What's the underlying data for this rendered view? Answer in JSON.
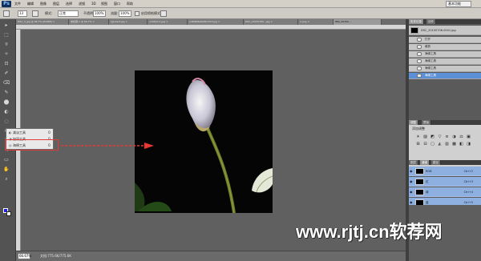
{
  "app": {
    "logo": "Ps",
    "workspace": "基本功能"
  },
  "menu_items": [
    "文件",
    "编辑",
    "图像",
    "图层",
    "选择",
    "滤镜",
    "3D",
    "视图",
    "窗口",
    "帮助"
  ],
  "options": {
    "brush_size": "13",
    "mode_label": "模式:",
    "mode_value": "正常",
    "opacity_label": "不透明度:",
    "opacity_value": "100%",
    "flow_label": "流量:",
    "flow_value": "100%",
    "airbrush_label": "启用喷枪模式"
  },
  "tabs": [
    "DSC_3_jpg @ 66.7% (RGB/8) ×",
    "未标题-1 @ 66.7% ×",
    "rgb-text.jpg ×",
    "untitled-1.jpg ×",
    "ad6f6b8a8e8b7b7d.jpg ×",
    "DSC_20150706...jpg ×",
    "1.png ×",
    "IMG_20150..."
  ],
  "active_tab_index": 7,
  "tools": [
    "▸",
    "⬚",
    "⌾",
    "✧",
    "⊡",
    "✐",
    "⌫",
    "✎",
    "⬤",
    "◐",
    "◌",
    "⊕",
    "T",
    "↖",
    "▭",
    "✋",
    "⌕"
  ],
  "flyout": {
    "items": [
      {
        "icon": "◐",
        "label": "减淡工具",
        "key": "O"
      },
      {
        "icon": "◑",
        "label": "加深工具",
        "key": "O"
      },
      {
        "icon": "◎",
        "label": "海绵工具",
        "key": "O"
      }
    ]
  },
  "status": {
    "zoom": "66.67%",
    "doc_info": "文档:775.6K/775.6K"
  },
  "history": {
    "tabs": [
      "历史记录",
      "动作"
    ],
    "snapshot": "DSC_20150706-0001.jpg",
    "steps": [
      "打开",
      "裁剪",
      "海绵工具",
      "海绵工具",
      "海绵工具",
      "海绵工具"
    ],
    "selected_index": 5
  },
  "adjustments": {
    "tabs": [
      "调整",
      "蒙版"
    ],
    "title": "添加调整",
    "icons": [
      "☀",
      "▨",
      "◩",
      "▽",
      "≡",
      "◑",
      "⚖",
      "▣",
      "⊞",
      "⊟",
      "▢",
      "◭",
      "▥",
      "▩",
      "◧",
      "◨"
    ]
  },
  "layers": {
    "tabs": [
      "图层",
      "通道",
      "路径"
    ],
    "channels": [
      {
        "name": "RGB",
        "key": "Ctrl+2"
      },
      {
        "name": "红",
        "key": "Ctrl+3"
      },
      {
        "name": "绿",
        "key": "Ctrl+4"
      },
      {
        "name": "蓝",
        "key": "Ctrl+5"
      }
    ]
  },
  "watermark": "www.rjtj.cn软荐网",
  "colors": {
    "foreground": "#1b1bff",
    "background": "#ffffff",
    "highlight": "#e53935"
  }
}
